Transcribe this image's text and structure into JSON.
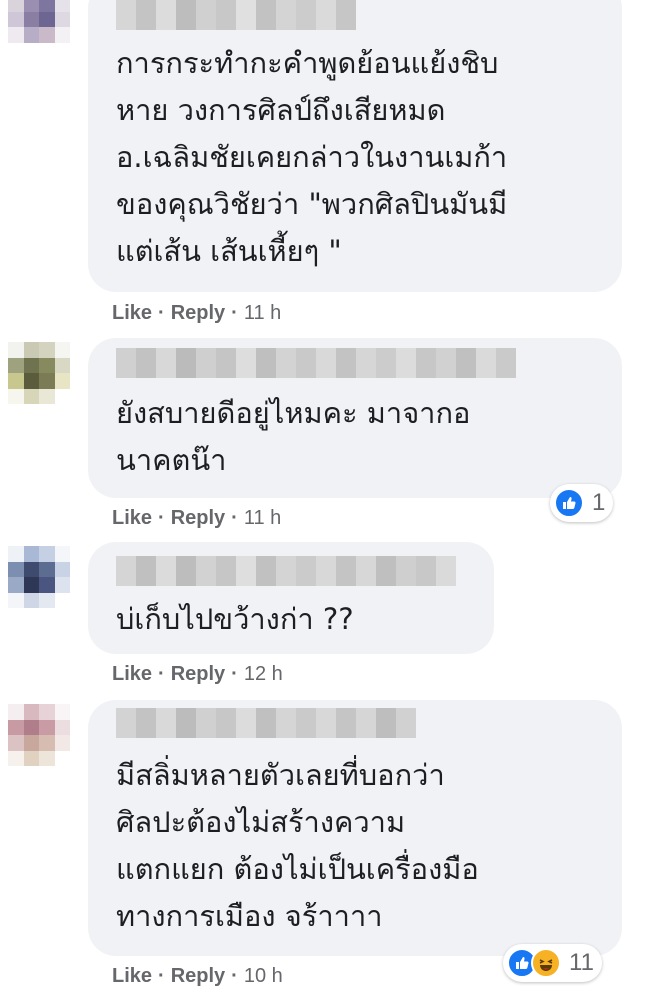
{
  "actions": {
    "like": "Like",
    "reply": "Reply",
    "separator": "·"
  },
  "comments": [
    {
      "text": "การกระทำกะคำพูดย้อนแย้งชิบ\nหาย วงการศิลป์ถึงเสียหมด\nอ.เฉลิมชัยเคยกล่าวในงานเมก้า\nของคุณวิชัยว่า \"พวกศิลปินมันมี\nแต่เส้น เส้นเหี้ยๆ \"",
      "time": "11 h"
    },
    {
      "text": "ยังสบายดีอยู่ไหมคะ มาจากอ\nนาคตน๊า",
      "time": "11 h",
      "reactions": {
        "icons": [
          "like-icon"
        ],
        "count": "1"
      }
    },
    {
      "text": "บ่เก็บไปขว้างก่า ??",
      "time": "12 h"
    },
    {
      "text": "มีสลิ่มหลายตัวเลยที่บอกว่า\nศิลปะต้องไม่สร้างความ\nแตกแยก ต้องไม่เป็นเครื่องมือ\nทางการเมือง จร้าาาา",
      "time": "10 h",
      "reactions": {
        "icons": [
          "like-icon",
          "haha-icon"
        ],
        "count": "11"
      }
    }
  ],
  "colors": {
    "bubble": "#f0f2f5",
    "text": "#1c1e21",
    "meta": "#65676b",
    "like": "#1877f2",
    "haha": "#f7b125"
  }
}
